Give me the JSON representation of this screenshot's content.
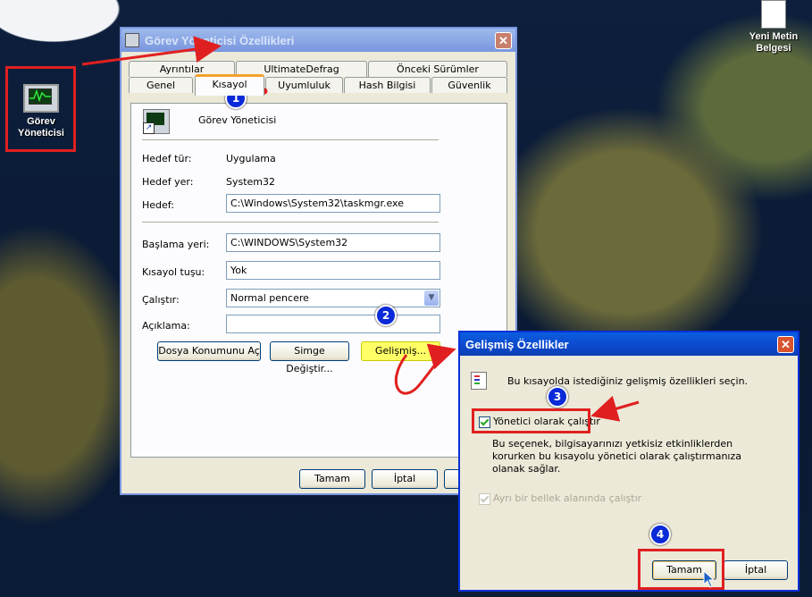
{
  "desktop": {
    "icon_taskmgr": "Görev Yöneticisi",
    "icon_textdoc": "Yeni Metin Belgesi"
  },
  "properties_window": {
    "title": "Görev Yöneticisi Özellikleri",
    "tabs_row1": [
      "Ayrıntılar",
      "UltimateDefrag",
      "Önceki Sürümler"
    ],
    "tabs_row2": [
      "Genel",
      "Kısayol",
      "Uyumluluk",
      "Hash Bilgisi",
      "Güvenlik"
    ],
    "app_name": "Görev Yöneticisi",
    "target_type_label": "Hedef tür:",
    "target_type_value": "Uygulama",
    "target_location_label": "Hedef yer:",
    "target_location_value": "System32",
    "target_label": "Hedef:",
    "target_value": "C:\\Windows\\System32\\taskmgr.exe",
    "start_in_label": "Başlama yeri:",
    "start_in_value": "C:\\WINDOWS\\System32",
    "shortcut_key_label": "Kısayol tuşu:",
    "shortcut_key_value": "Yok",
    "run_label": "Çalıştır:",
    "run_value": "Normal pencere",
    "comment_label": "Açıklama:",
    "comment_value": "",
    "open_location_button": "Dosya Konumunu Aç",
    "change_icon_button": "Simge Değiştir...",
    "advanced_button": "Gelişmiş...",
    "ok_button": "Tamam",
    "cancel_button": "İptal"
  },
  "advanced_dialog": {
    "title": "Gelişmiş Özellikler",
    "intro": "Bu kısayolda istediğiniz gelişmiş özellikleri seçin.",
    "run_as_admin": "Yönetici olarak çalıştır",
    "run_as_admin_checked": true,
    "explanation": "Bu seçenek, bilgisayarınızı yetkisiz etkinliklerden korurken bu kısayolu yönetici olarak çalıştırmanıza olanak sağlar.",
    "separate_memory": "Ayrı bir bellek alanında çalıştır",
    "separate_memory_checked": true,
    "ok_button": "Tamam",
    "cancel_button": "İptal"
  },
  "badges": [
    "1",
    "2",
    "3",
    "4"
  ],
  "colors": {
    "highlight": "#e02020",
    "badge": "#0b2ad8",
    "advanced_highlight": "#ffff66"
  }
}
